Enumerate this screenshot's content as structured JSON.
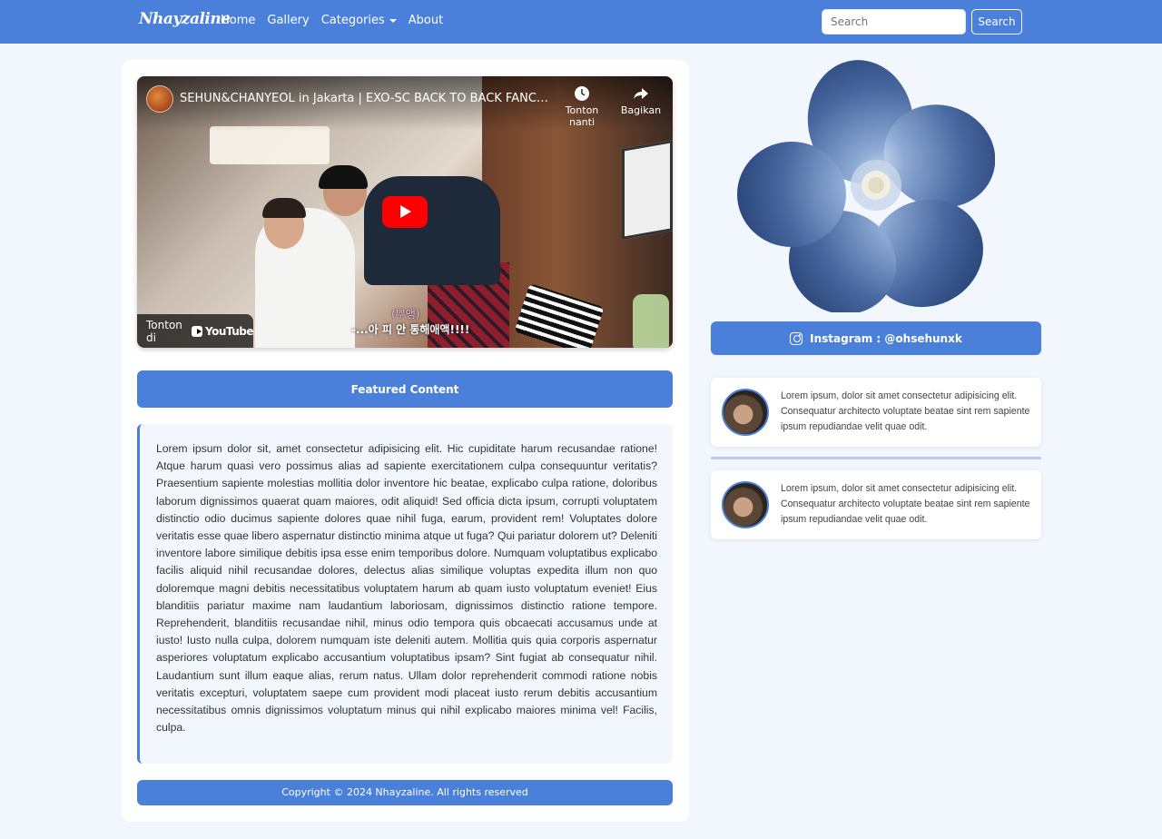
{
  "navbar": {
    "brand": "Nhayzaline",
    "links": [
      "Home",
      "Gallery",
      "Categories",
      "About"
    ],
    "search_placeholder": "Search",
    "search_button": "Search"
  },
  "video": {
    "title": "SEHUN&CHANYEOL in Jakarta | EXO-SC BACK TO BACK FANCON ...",
    "watch_later": "Tonton nanti",
    "share": "Bagikan",
    "watch_on": "Tonton di",
    "youtube": "YouTube",
    "subtitle_small": "(뿌앵)",
    "subtitle": "-...아 피 안 통해애액!!!!"
  },
  "featured_button": "Featured Content",
  "article_text": "Lorem ipsum dolor sit, amet consectetur adipisicing elit. Hic cupiditate harum recusandae ratione! Atque harum quasi vero possimus alias ad sapiente exercitationem culpa consequuntur veritatis? Praesentium sapiente molestias mollitia dolor inventore hic beatae, explicabo culpa ratione, doloribus laborum dignissimos quaerat quam maiores, odit aliquid! Sed officia dicta ipsum, corrupti voluptatem distinctio odio ducimus sapiente dolores quae nihil fuga, earum, provident rem! Voluptates dolore veritatis esse quae libero aspernatur distinctio minima atque ut fuga? Qui pariatur dolorem ut? Deleniti inventore labore similique debitis ipsa esse enim temporibus dolore. Numquam voluptatibus explicabo facilis aliquid nihil recusandae dolores, delectus alias similique voluptas expedita illum non quo doloremque magni debitis necessitatibus voluptatem harum ab quam iusto voluptatum eveniet! Eius blanditiis pariatur maxime nam laudantium laboriosam, dignissimos distinctio ratione tempore. Reprehenderit, blanditiis recusandae nihil, minus odio tempora quis obcaecati accusamus unde at iusto! Iusto nulla culpa, dolorem numquam iste deleniti autem. Mollitia quis quia corporis aspernatur asperiores voluptatum explicabo accusantium voluptatibus ipsam? Sint fugiat ab consequatur nihil. Laudantium sunt illum eaque alias, rerum natus. Ullam dolor reprehenderit commodi ratione nobis veritatis excepturi, voluptatem saepe cum provident modi placeat iusto rerum debitis accusantium necessitatibus omnis dignissimos voluptatum minus qui nihil explicabo maiores minima vel! Facilis, culpa.",
  "footer": "Copyright © 2024 Nhayzaline. All rights reserved",
  "instagram_button": "Instagram : @ohsehunxk",
  "posts": [
    {
      "text": "Lorem ipsum, dolor sit amet consectetur adipisicing elit. Consequatur architecto voluptate beatae sint rem sapiente ipsum repudiandae velit quae odit."
    },
    {
      "text": "Lorem ipsum, dolor sit amet consectetur adipisicing elit. Consequatur architecto voluptate beatae sint rem sapiente ipsum repudiandae velit quae odit."
    }
  ],
  "colors": {
    "primary": "#4a80d9",
    "background": "#f2f6fd",
    "youtube_red": "#ff0000"
  },
  "icons": [
    "instagram-icon",
    "play-icon",
    "clock-icon",
    "share-icon",
    "caret-down-icon",
    "youtube-logo-icon"
  ]
}
